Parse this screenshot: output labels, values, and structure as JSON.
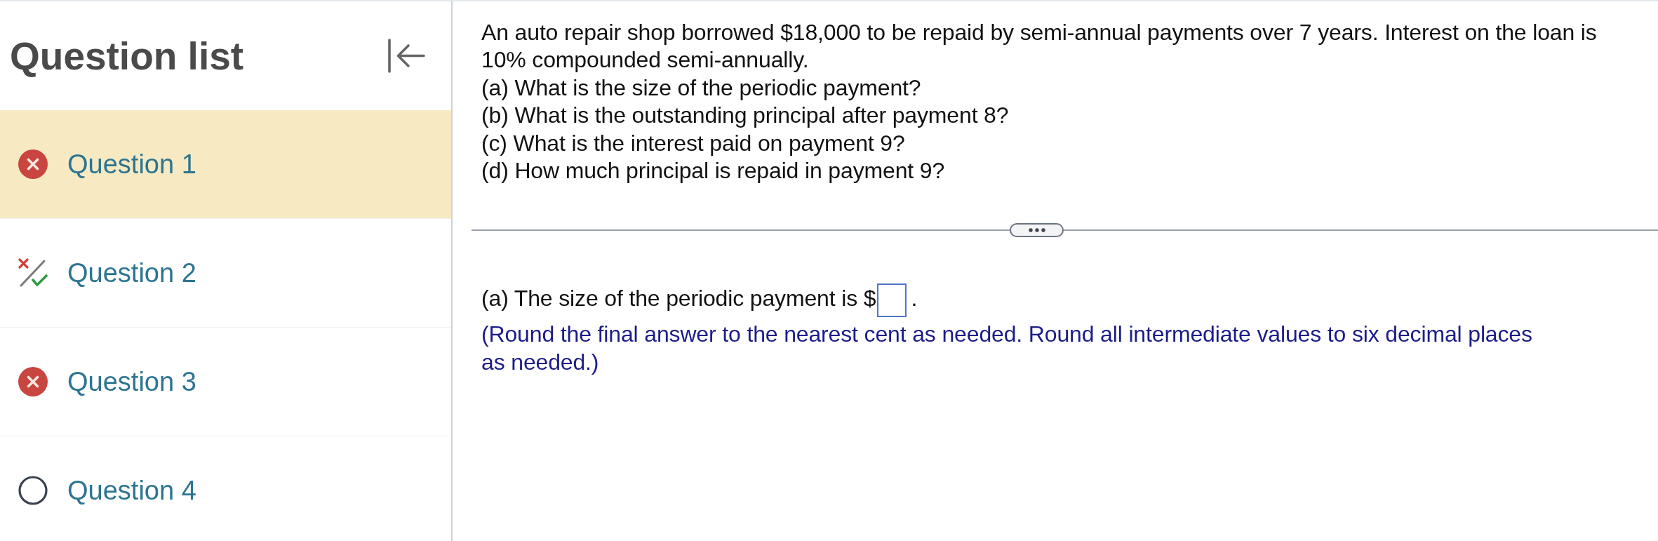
{
  "sidebar": {
    "title": "Question list",
    "questions": [
      {
        "label": "Question 1",
        "kind": "incorrect",
        "selected": true
      },
      {
        "label": "Question 2",
        "kind": "partial",
        "selected": false
      },
      {
        "label": "Question 3",
        "kind": "incorrect",
        "selected": false
      },
      {
        "label": "Question 4",
        "kind": "unanswered",
        "selected": false
      }
    ]
  },
  "question": {
    "stem": "An auto repair shop borrowed $18,000 to be repaid by semi-annual payments over 7 years. Interest on the loan is 10% compounded semi-annually.",
    "parts": [
      "(a) What is the size of the periodic payment?",
      "(b) What is the outstanding principal after payment 8?",
      "(c) What is the interest paid on payment 9?",
      "(d) How much principal is repaid in payment 9?"
    ]
  },
  "answer": {
    "prompt": "(a) The size of the periodic payment is $",
    "suffix": ".",
    "hint": "(Round the final answer to the nearest cent as needed. Round all intermediate values to six decimal places as needed.)"
  }
}
